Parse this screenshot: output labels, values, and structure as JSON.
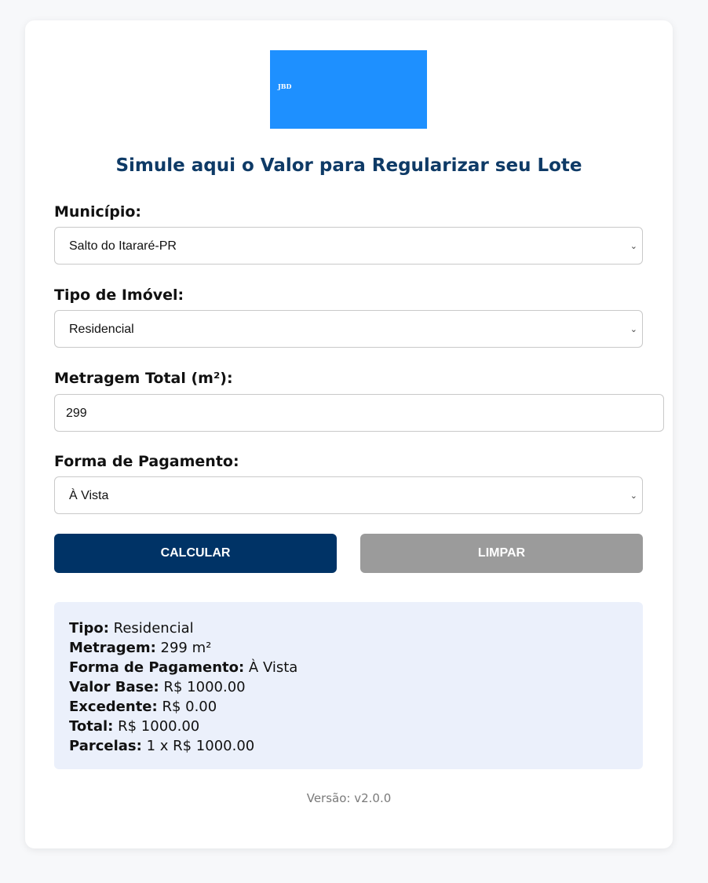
{
  "logo": {
    "text": "JBD",
    "color": "#1e90ff"
  },
  "page_title": "Simule aqui o Valor para Regularizar seu Lote",
  "form": {
    "municipio": {
      "label": "Município:",
      "value": "Salto do Itararé-PR"
    },
    "tipo_imovel": {
      "label": "Tipo de Imóvel:",
      "value": "Residencial"
    },
    "metragem": {
      "label": "Metragem Total (m²):",
      "value": "299"
    },
    "pagamento": {
      "label": "Forma de Pagamento:",
      "value": "À Vista"
    }
  },
  "buttons": {
    "calcular": "CALCULAR",
    "limpar": "LIMPAR"
  },
  "result": {
    "tipo": {
      "label": "Tipo:",
      "value": "Residencial"
    },
    "metragem": {
      "label": "Metragem:",
      "value": "299 m²"
    },
    "pagamento": {
      "label": "Forma de Pagamento:",
      "value": "À Vista"
    },
    "valor_base": {
      "label": "Valor Base:",
      "value": "R$ 1000.00"
    },
    "excedente": {
      "label": "Excedente:",
      "value": "R$ 0.00"
    },
    "total": {
      "label": "Total:",
      "value": "R$ 1000.00"
    },
    "parcelas": {
      "label": "Parcelas:",
      "value": "1 x R$ 1000.00"
    }
  },
  "version": "Versão: v2.0.0",
  "colors": {
    "primary": "#003366",
    "title": "#0e3a66",
    "secondary_button": "#9b9b9b",
    "result_bg": "#ebf0fb"
  }
}
